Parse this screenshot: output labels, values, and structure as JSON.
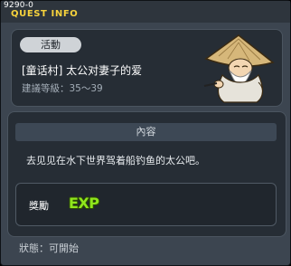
{
  "window": {
    "id": "9290-0",
    "title": "QUEST INFO"
  },
  "quest": {
    "tag": "活動",
    "name": "[童话村] 太公对妻子的爱",
    "level": "建議等級：35～39"
  },
  "content": {
    "header": "內容",
    "text": "去见见在水下世界驾着船钓鱼的太公吧。"
  },
  "reward": {
    "label": "獎勵",
    "exp_badge": "EXP"
  },
  "status": {
    "text": "狀態：可開始"
  },
  "icons": {
    "npc": "old-fisherman-npc-icon",
    "exp": "exp-icon"
  },
  "colors": {
    "title": "#f7d33c",
    "exp": "#8fe61c",
    "background": "#3c4550",
    "panel": "#262d35"
  }
}
